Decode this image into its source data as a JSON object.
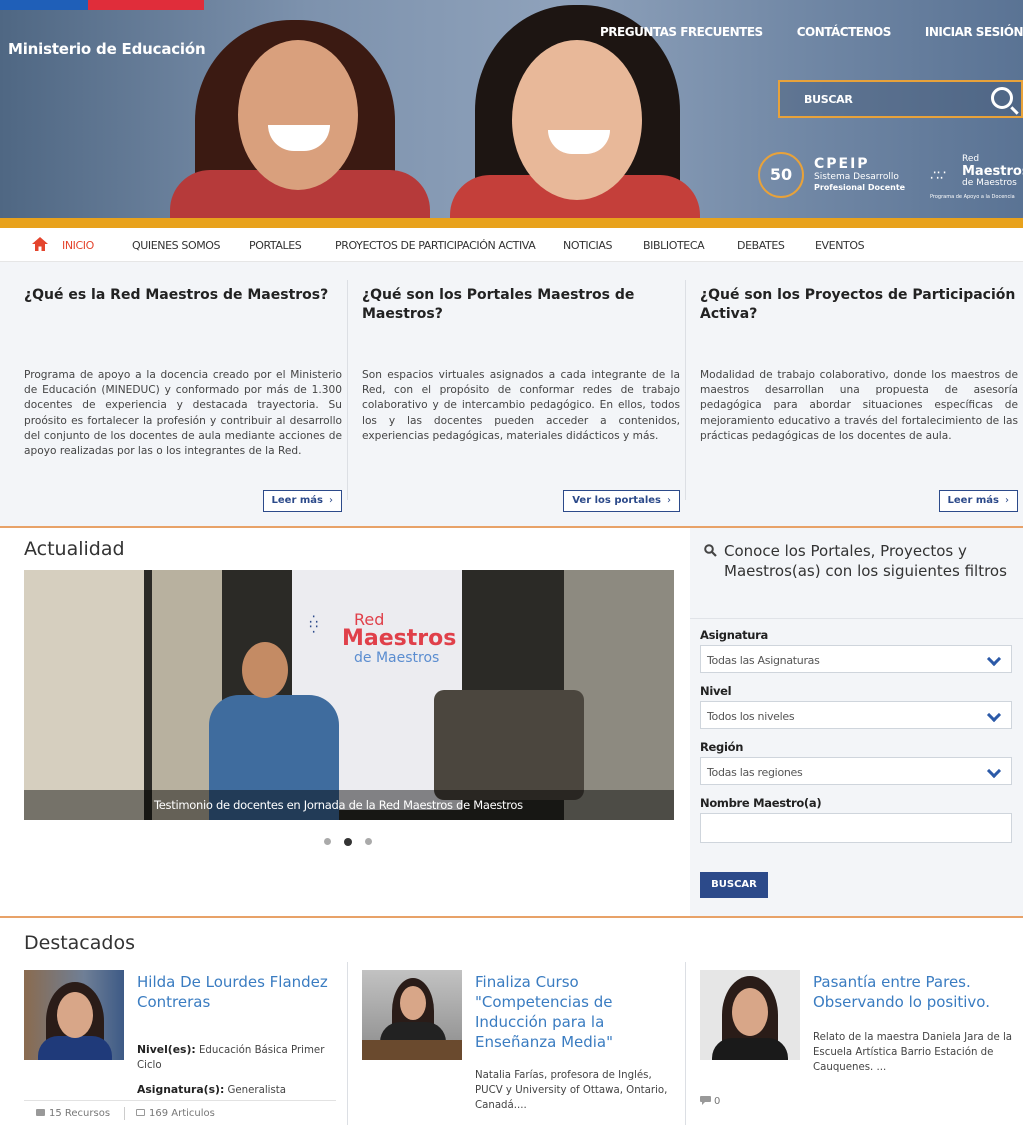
{
  "header": {
    "ministry": "Ministerio de Educación",
    "top_links": [
      "PREGUNTAS FRECUENTES",
      "CONTÁCTENOS",
      "INICIAR SESIÓN"
    ],
    "search_placeholder": "BUSCAR",
    "cpeip": {
      "badge": "50",
      "name": "CPEIP",
      "line1": "Sistema Desarrollo",
      "line2": "Profesional Docente"
    },
    "red_logo": {
      "line1": "Red",
      "line2": "Maestros",
      "line3": "de Maestros",
      "tagline": "Programa de Apoyo a la Docencia"
    }
  },
  "nav": {
    "items": [
      "INICIO",
      "QUIENES SOMOS",
      "PORTALES",
      "PROYECTOS DE PARTICIPACIÓN ACTIVA",
      "NOTICIAS",
      "BIBLIOTECA",
      "DEBATES",
      "EVENTOS"
    ],
    "active": "INICIO"
  },
  "intro": [
    {
      "title": "¿Qué es la Red Maestros de Maestros?",
      "text": "Programa de apoyo a la docencia creado por el Ministerio de Educación (MINEDUC) y conformado por más de 1.300 docentes de experiencia y destacada trayectoria. Su proósito es fortalecer la profesión y contribuir al desarrollo del conjunto de los docentes de aula mediante acciones de apoyo realizadas por las o los integrantes de la Red.",
      "button": "Leer más"
    },
    {
      "title": "¿Qué son los Portales Maestros de Maestros?",
      "text": "Son espacios virtuales asignados a cada integrante de la Red, con el propósito de conformar redes de trabajo colaborativo y de intercambio pedagógico. En ellos, todos los y las docentes pueden acceder a contenidos, experiencias pedagógicas, materiales didácticos y más.",
      "button": "Ver los portales"
    },
    {
      "title": "¿Qué son los Proyectos de Participación Activa?",
      "text": "Modalidad de trabajo colaborativo, donde los maestros de maestros desarrollan una propuesta de asesoría pedagógica para abordar situaciones específicas de mejoramiento educativo a través del fortalecimiento de las prácticas pedagógicas de los docentes de aula.",
      "button": "Leer más"
    }
  ],
  "actualidad": {
    "title": "Actualidad",
    "caption": "Testimonio de docentes en Jornada de la Red Maestros de Maestros",
    "slide_banner": {
      "line1": "Red",
      "line2": "Maestros",
      "line3": "de Maestros"
    },
    "slides_total": 3,
    "slide_active": 2
  },
  "filters": {
    "title": "Conoce los Portales, Proyectos y Maestros(as) con los siguientes filtros",
    "fields": [
      {
        "label": "Asignatura",
        "value": "Todas las Asignaturas"
      },
      {
        "label": "Nivel",
        "value": "Todos los niveles"
      },
      {
        "label": "Región",
        "value": "Todas las regiones"
      }
    ],
    "name_label": "Nombre Maestro(a)",
    "button": "BUSCAR"
  },
  "destacados": {
    "title": "Destacados",
    "cards": [
      {
        "title": "Hilda De Lourdes Flandez Contreras",
        "nivel_label": "Nivel(es):",
        "nivel": "Educación Básica Primer Ciclo",
        "asig_label": "Asignatura(s):",
        "asig": "Generalista",
        "recursos": "15 Recursos",
        "articulos": "169 Articulos"
      },
      {
        "title": "Finaliza Curso \"Competencias de Inducción para la Enseñanza Media\"",
        "text": "Natalia Farías, profesora de Inglés, PUCV y University of Ottawa, Ontario, Canadá...."
      },
      {
        "title": "Pasantía entre Pares. Observando lo positivo.",
        "text": "Relato de la maestra Daniela Jara de la Escuela Artística Barrio Estación de Cauquenes. ...",
        "comments": "0"
      }
    ]
  },
  "colors": {
    "accent_orange": "#e8a21c",
    "nav_active": "#e4442d",
    "brand_blue": "#2c4a8a",
    "link_blue": "#3a7cc1"
  }
}
